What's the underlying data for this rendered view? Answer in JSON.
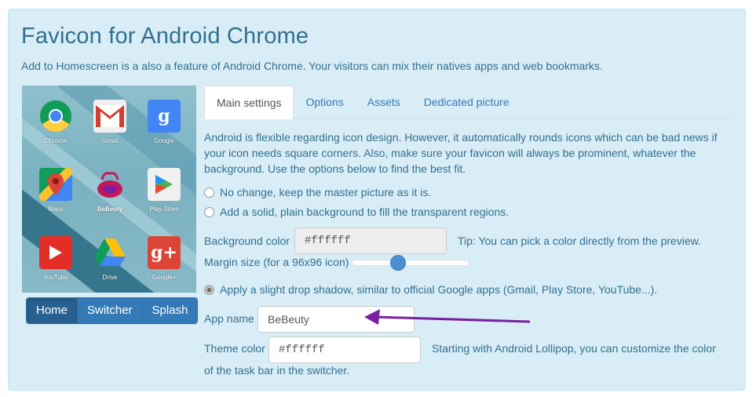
{
  "header": {
    "title": "Favicon for Android Chrome",
    "subtitle": "Add to Homescreen is a also a feature of Android Chrome. Your visitors can mix their natives apps and web bookmarks."
  },
  "preview": {
    "apps": [
      {
        "name": "Chrome",
        "icon": "chrome-icon"
      },
      {
        "name": "Gmail",
        "icon": "gmail-icon"
      },
      {
        "name": "Google",
        "icon": "google-icon"
      },
      {
        "name": "Maps",
        "icon": "maps-icon"
      },
      {
        "name": "BeBeuty",
        "icon": "bebeuty-icon"
      },
      {
        "name": "Play Store",
        "icon": "play-store-icon"
      },
      {
        "name": "YouTube",
        "icon": "youtube-icon"
      },
      {
        "name": "Drive",
        "icon": "drive-icon"
      },
      {
        "name": "Google+",
        "icon": "google-plus-icon"
      }
    ],
    "google_glyph": "g",
    "googleplus_glyph": "g+"
  },
  "view_buttons": {
    "home": "Home",
    "switcher": "Switcher",
    "splash": "Splash",
    "active": "Home"
  },
  "tabs": [
    "Main settings",
    "Options",
    "Assets",
    "Dedicated picture"
  ],
  "active_tab": "Main settings",
  "main": {
    "intro": "Android is flexible regarding icon design. However, it automatically rounds icons which can be bad news if your icon needs square corners. Also, make sure your favicon will always be prominent, whatever the background. Use the options below to find the best fit.",
    "option_no_change": "No change, keep the master picture as it is.",
    "option_solid_bg": "Add a solid, plain background to fill the transparent regions.",
    "bg_color_label": "Background color",
    "bg_color_value": "#ffffff",
    "bg_color_tip": "Tip: You can pick a color directly from the preview.",
    "margin_label": "Margin size (for a 96x96 icon)",
    "margin_slider_level": 0.39,
    "shadow_label": "Apply a slight drop shadow, similar to official Google apps (Gmail, Play Store, YouTube...).",
    "app_name_label": "App name",
    "app_name_value": "BeBeuty",
    "theme_color_label": "Theme color",
    "theme_color_value": "#ffffff",
    "theme_color_tip_1": "Starting with Android Lollipop, you can customize the color",
    "theme_color_tip_2": "of the task bar in the switcher."
  },
  "colors": {
    "panel_bg": "#d9edf7",
    "text": "#31708f",
    "button_primary": "#337ab7",
    "annotation_arrow": "#7b1fa2"
  }
}
